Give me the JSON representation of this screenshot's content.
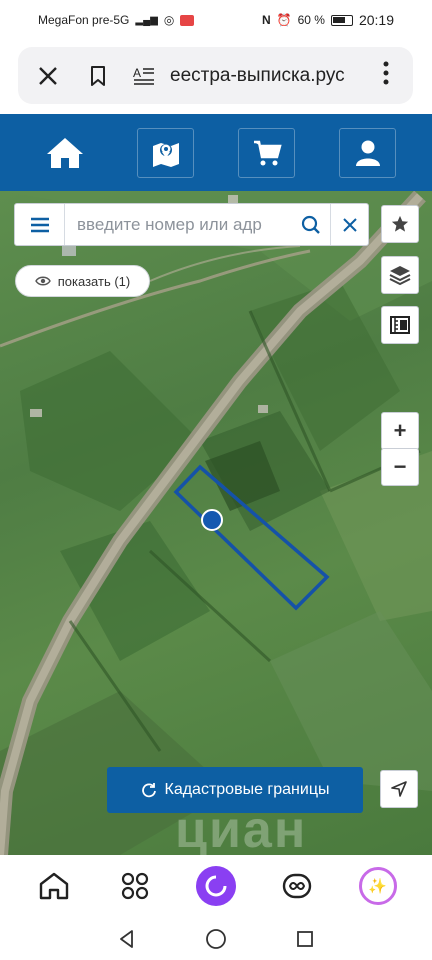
{
  "status_bar": {
    "carrier": "MegaFon pre-5G",
    "battery": "60 %",
    "time": "20:19"
  },
  "browser": {
    "url": "еестра-выписка.рус",
    "icons": [
      "close-icon",
      "bookmark-icon",
      "reader-mode-icon",
      "menu-dots-icon"
    ]
  },
  "site_nav": {
    "items": [
      "home-icon",
      "map-icon",
      "cart-icon",
      "user-icon"
    ],
    "accent": "#0d5fa3"
  },
  "search": {
    "placeholder": "введите номер или адр"
  },
  "show_button": {
    "label": "показать (1)"
  },
  "map_controls": {
    "zoom_in": "+",
    "zoom_out": "−"
  },
  "cadastral_button": {
    "label": "Кадастровые границы"
  },
  "watermark": {
    "text": "циан"
  },
  "dock": {
    "items": [
      "home-icon",
      "apps-icon",
      "alice-icon",
      "infinity-icon",
      "sparkle-icon"
    ]
  }
}
